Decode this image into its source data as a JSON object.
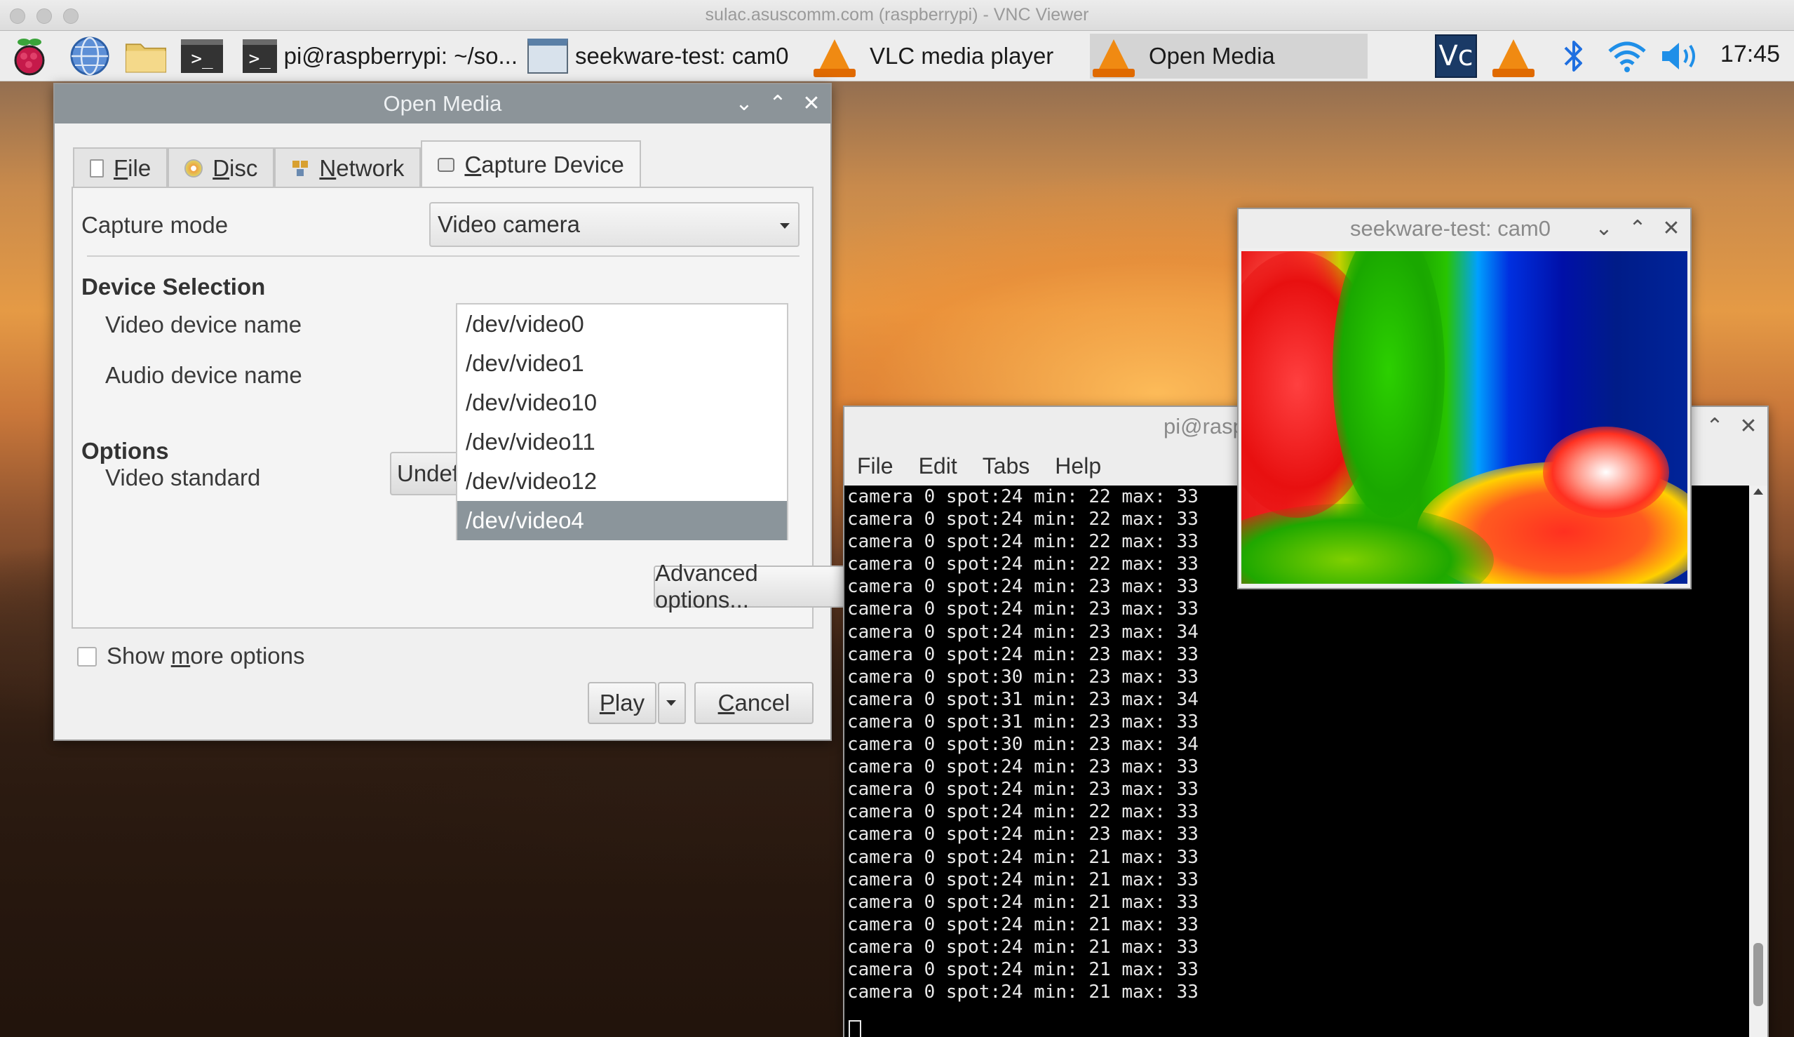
{
  "vnc": {
    "title": "sulac.asuscomm.com (raspberrypi) - VNC Viewer"
  },
  "taskbar": {
    "tasks": [
      {
        "label": "pi@raspberrypi: ~/so...",
        "icon": "terminal-icon"
      },
      {
        "label": "seekware-test: cam0",
        "icon": "window-icon"
      },
      {
        "label": "VLC media player",
        "icon": "vlc-cone-icon"
      },
      {
        "label": "Open Media",
        "icon": "vlc-cone-icon"
      }
    ],
    "tray": [
      "vnc-icon",
      "vlc-cone-icon",
      "bluetooth-icon",
      "wifi-icon",
      "volume-icon"
    ],
    "clock": "17:45",
    "launchers": [
      "raspberry-menu-icon",
      "browser-globe-icon",
      "file-manager-folder-icon",
      "terminal-icon"
    ]
  },
  "open_media": {
    "title": "Open Media",
    "tabs": [
      {
        "label": "File",
        "mnemonic": "F"
      },
      {
        "label": "Disc",
        "mnemonic": "D"
      },
      {
        "label": "Network",
        "mnemonic": "N"
      },
      {
        "label": "Capture Device",
        "mnemonic": "C",
        "active": true
      }
    ],
    "capture_mode": {
      "label": "Capture mode",
      "value": "Video camera"
    },
    "device_selection": {
      "heading": "Device Selection",
      "video_label": "Video device name",
      "audio_label": "Audio device name",
      "devices": [
        "/dev/video0",
        "/dev/video1",
        "/dev/video10",
        "/dev/video11",
        "/dev/video12",
        "/dev/video4"
      ],
      "selected": "/dev/video4"
    },
    "options": {
      "heading": "Options",
      "video_standard_label": "Video standard",
      "video_standard_value": "Undef"
    },
    "advanced_button": "Advanced options...",
    "show_more": {
      "pre": "Show ",
      "mnemonic": "m",
      "post": "ore options",
      "checked": false
    },
    "play_button": {
      "mnemonic": "P",
      "rest": "lay"
    },
    "cancel_button": {
      "mnemonic": "C",
      "rest": "ancel"
    }
  },
  "terminal": {
    "title": "pi@raspberrypi: ~",
    "menu": [
      "File",
      "Edit",
      "Tabs",
      "Help"
    ],
    "lines": [
      "camera 0 spot:24 min: 22 max: 33",
      "camera 0 spot:24 min: 22 max: 33",
      "camera 0 spot:24 min: 22 max: 33",
      "camera 0 spot:24 min: 22 max: 33",
      "camera 0 spot:24 min: 23 max: 33",
      "camera 0 spot:24 min: 23 max: 33",
      "camera 0 spot:24 min: 23 max: 34",
      "camera 0 spot:24 min: 23 max: 33",
      "camera 0 spot:30 min: 23 max: 33",
      "camera 0 spot:31 min: 23 max: 34",
      "camera 0 spot:31 min: 23 max: 33",
      "camera 0 spot:30 min: 23 max: 34",
      "camera 0 spot:24 min: 23 max: 33",
      "camera 0 spot:24 min: 23 max: 33",
      "camera 0 spot:24 min: 22 max: 33",
      "camera 0 spot:24 min: 23 max: 33",
      "camera 0 spot:24 min: 21 max: 33",
      "camera 0 spot:24 min: 21 max: 33",
      "camera 0 spot:24 min: 21 max: 33",
      "camera 0 spot:24 min: 21 max: 33",
      "camera 0 spot:24 min: 21 max: 33",
      "camera 0 spot:24 min: 21 max: 33",
      "camera 0 spot:24 min: 21 max: 33"
    ]
  },
  "seekware": {
    "title": "seekware-test: cam0"
  },
  "colors": {
    "titlebar": "#8c9499",
    "selection": "#8b959b",
    "terminal_bg": "#000000",
    "terminal_fg": "#e8e8e8",
    "vlc_orange": "#f08a12",
    "bluetooth_blue": "#1f6fe0"
  }
}
